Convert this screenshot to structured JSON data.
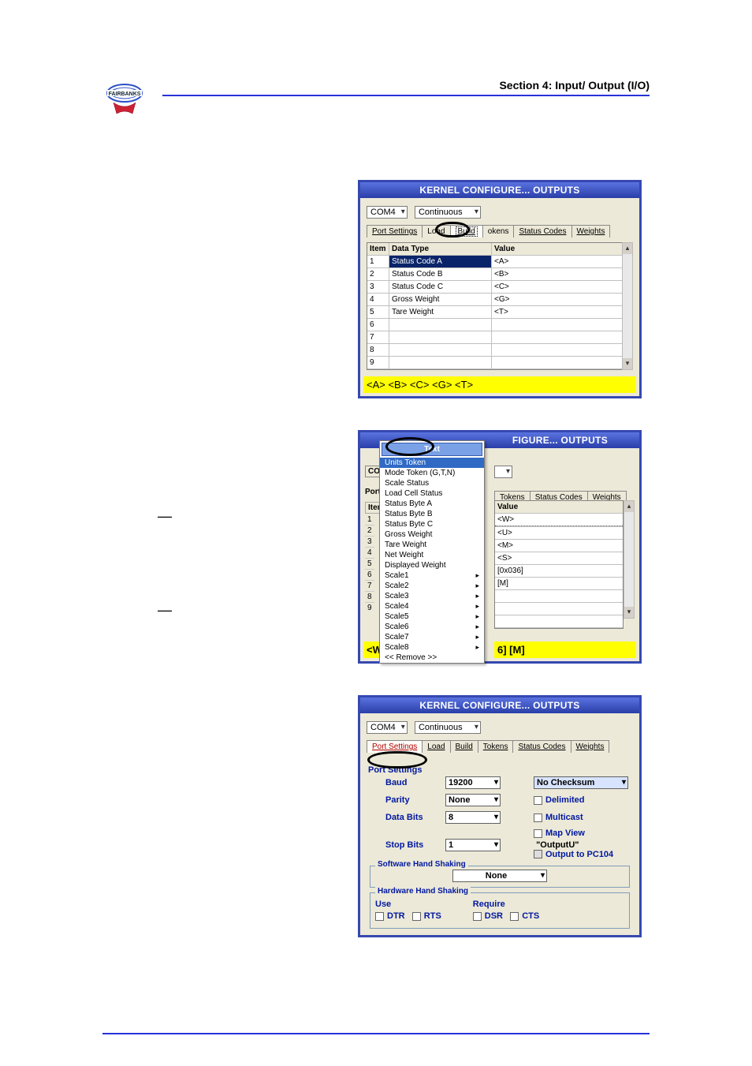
{
  "page": {
    "section_header": "Section 4: Input/ Output (I/O)"
  },
  "win1": {
    "title": "KERNEL CONFIGURE... OUTPUTS",
    "port_value": "COM4",
    "mode_value": "Continuous",
    "tabs": {
      "port_settings": "Port Settings",
      "load": "Load",
      "build": "Build",
      "tokens": "okens",
      "status_codes": "Status Codes",
      "weights": "Weights"
    },
    "grid_headers": {
      "item": "Item",
      "type": "Data Type",
      "value": "Value"
    },
    "rows": [
      {
        "n": "1",
        "type": "Status Code A",
        "value": "<A>"
      },
      {
        "n": "2",
        "type": "Status Code B",
        "value": "<B>"
      },
      {
        "n": "3",
        "type": "Status Code C",
        "value": "<C>"
      },
      {
        "n": "4",
        "type": "Gross Weight",
        "value": "<G>"
      },
      {
        "n": "5",
        "type": "Tare Weight",
        "value": "<T>"
      },
      {
        "n": "6",
        "type": "",
        "value": ""
      },
      {
        "n": "7",
        "type": "",
        "value": ""
      },
      {
        "n": "8",
        "type": "",
        "value": ""
      },
      {
        "n": "9",
        "type": "",
        "value": ""
      }
    ],
    "yellow": "<A> <B> <C> <G> <T>"
  },
  "win2": {
    "title_right": "FIGURE... OUTPUTS",
    "popup_header": "Text",
    "popup_subheader": "Units Token",
    "com_label": "COM",
    "port_s": "Port S",
    "item_label": "Item",
    "tabs": {
      "tokens": "Tokens",
      "status_codes": "Status Codes",
      "weights": "Weights"
    },
    "menu": [
      "Mode Token (G,T,N)",
      "Scale Status",
      "Load Cell Status",
      "Status Byte A",
      "Status Byte B",
      "Status Byte C",
      "Gross Weight",
      "Tare Weight",
      "Net Weight",
      "Displayed Weight",
      "Scale1",
      "Scale2",
      "Scale3",
      "Scale4",
      "Scale5",
      "Scale6",
      "Scale7",
      "Scale8",
      "<< Remove >>"
    ],
    "value_header": "Value",
    "left_nums": [
      "1",
      "2",
      "3",
      "4",
      "5",
      "6",
      "7",
      "8",
      "9"
    ],
    "values": [
      "<W>",
      "<U>",
      "<M>",
      "<S>",
      "[0x036]",
      "[M]",
      "",
      "",
      ""
    ],
    "yellow_left": "<W>",
    "yellow_right": "6] [M]"
  },
  "win3": {
    "title": "KERNEL CONFIGURE... OUTPUTS",
    "port_value": "COM4",
    "mode_value": "Continuous",
    "tabs": {
      "port_settings": "Port Settings",
      "load": "Load",
      "build": "Build",
      "tokens": "Tokens",
      "status_codes": "Status Codes",
      "weights": "Weights"
    },
    "group_title": "Port Settings",
    "baud_label": "Baud",
    "baud_value": "19200",
    "parity_label": "Parity",
    "parity_value": "None",
    "databits_label": "Data Bits",
    "databits_value": "8",
    "stopbits_label": "Stop Bits",
    "stopbits_value": "1",
    "checksum_value": "No Checksum",
    "chk_delimited": "Delimited",
    "chk_multicast": "Multicast",
    "chk_mapview": "Map View",
    "mapview_extra": "\"OutputU\"",
    "chk_pc104": "Output to PC104",
    "sw_legend": "Software Hand Shaking",
    "sw_value": "None",
    "hw_legend": "Hardware Hand Shaking",
    "hw_use": "Use",
    "hw_require": "Require",
    "dtr": "DTR",
    "rts": "RTS",
    "dsr": "DSR",
    "cts": "CTS"
  }
}
